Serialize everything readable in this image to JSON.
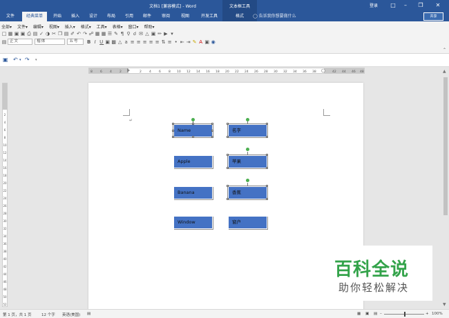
{
  "title_bar": {
    "title": "文档1 [兼容模式] - Word",
    "contextual_tab_group": "文本框工具",
    "login": "登录"
  },
  "ribbon_tabs": [
    {
      "label": "文件"
    },
    {
      "label": "经典菜单"
    },
    {
      "label": "开始"
    },
    {
      "label": "插入"
    },
    {
      "label": "设计"
    },
    {
      "label": "布局"
    },
    {
      "label": "引用"
    },
    {
      "label": "邮件"
    },
    {
      "label": "审阅"
    },
    {
      "label": "视图"
    },
    {
      "label": "开发工具"
    },
    {
      "label": "格式"
    }
  ],
  "tell_me": "告诉我你想要做什么",
  "share": "共享",
  "menu_row": [
    {
      "label": "全部▾"
    },
    {
      "label": "文件▾"
    },
    {
      "label": "编辑▾"
    },
    {
      "label": "视图▾"
    },
    {
      "label": "插入▾"
    },
    {
      "label": "格式▾"
    },
    {
      "label": "工具▾"
    },
    {
      "label": "表格▾"
    },
    {
      "label": "窗口▾"
    },
    {
      "label": "帮助▾"
    }
  ],
  "format_row": {
    "style": "正文",
    "font": "楷体",
    "size": "五号"
  },
  "page": {
    "left_boxes": [
      {
        "text": "Name"
      },
      {
        "text": "Apple"
      },
      {
        "text": "Banana"
      },
      {
        "text": "Window"
      }
    ],
    "right_boxes": [
      {
        "text": "名字"
      },
      {
        "text": "苹果"
      },
      {
        "text": "香蕉"
      },
      {
        "text": "窗户"
      }
    ]
  },
  "watermark": {
    "big": "百科全说",
    "small": "助你轻松解决"
  },
  "status_bar": {
    "page": "第 1 页，共 1 页",
    "words": "12 个字",
    "language": "英语(美国)",
    "zoom": "100%"
  },
  "colors": {
    "ribbon": "#2b579a",
    "textbox_fill": "#4472c4",
    "watermark_green": "#33a34a"
  }
}
